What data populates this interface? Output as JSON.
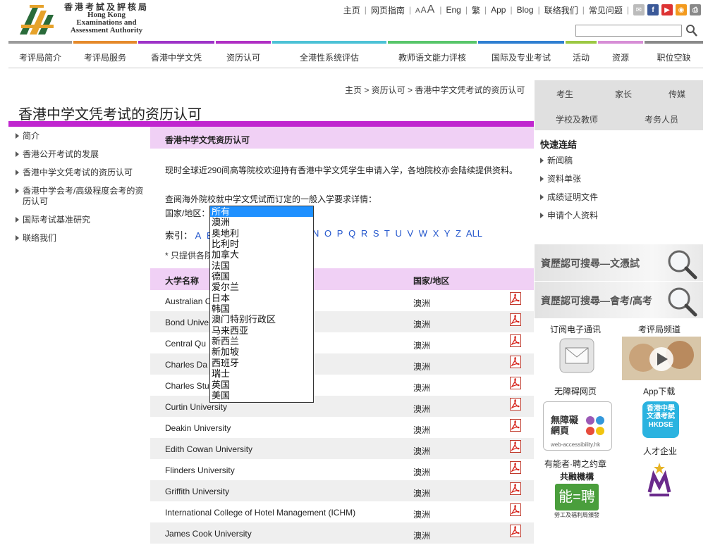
{
  "header": {
    "logo_zh": "香港考試及評核局",
    "logo_en1": "Hong Kong",
    "logo_en2": "Examinations and",
    "logo_en3": "Assessment Authority",
    "links": [
      "主页",
      "网页指南"
    ],
    "font_size_label": "AAA",
    "lang_links": [
      "Eng",
      "繁"
    ],
    "other_links": [
      "App",
      "Blog",
      "联络我们",
      "常见问题"
    ],
    "search_placeholder": ""
  },
  "nav": {
    "items": [
      {
        "label": "考评局简介",
        "color": "#9b9b9b"
      },
      {
        "label": "考评局服务",
        "color": "#e58a2b"
      },
      {
        "label": "香港中学文凭",
        "color": "#9e34c8"
      },
      {
        "label": "资历认可",
        "color": "#b02fc4"
      },
      {
        "label": "全港性系统评估",
        "color": "#4cc2d6"
      },
      {
        "label": "教师语文能力评核",
        "color": "#58c66a"
      },
      {
        "label": "国际及专业考试",
        "color": "#2f7fd1"
      },
      {
        "label": "活动",
        "color": "#9cc843"
      },
      {
        "label": "资源",
        "color": "#d78ed6"
      },
      {
        "label": "职位空缺",
        "color": "#8a8a8a"
      }
    ]
  },
  "breadcrumb": "主页 > 资历认可 > 香港中学文凭考试的资历认可",
  "page_title": "香港中学文凭考试的资历认可",
  "sidebar": {
    "items": [
      {
        "label": "简介"
      },
      {
        "label": "香港公开考试的发展"
      },
      {
        "label": "香港中学文凭考试的资历认可"
      },
      {
        "label": "香港中学会考/高级程度会考的资历认可"
      },
      {
        "label": "国际考试基准研究"
      },
      {
        "label": "联络我们"
      }
    ]
  },
  "content": {
    "section_title": "香港中学文凭资历认可",
    "intro": "现时全球近290间高等院校欢迎持有香港中学文凭学生申请入学，各地院校亦会陆续提供资料。",
    "query": "查阅海外院校就中学文凭试而订定的一般入学要求详情：",
    "region_label": "国家/地区：",
    "index_label": "索引：",
    "index_letters_left": [
      "A",
      "B"
    ],
    "index_letters_right": [
      "N",
      "O",
      "P",
      "Q",
      "R",
      "S",
      "T",
      "U",
      "V",
      "W",
      "X",
      "Y",
      "Z",
      "ALL"
    ],
    "note": "* 只提供各院",
    "col_university": "大学名称",
    "col_country": "国家/地区",
    "rows": [
      {
        "name": "Australian C",
        "country": "澳洲"
      },
      {
        "name": "Bond Unive",
        "country": "澳洲"
      },
      {
        "name": "Central Qu",
        "country": "澳洲"
      },
      {
        "name": "Charles Da",
        "country": "澳洲"
      },
      {
        "name": "Charles Stu",
        "country": "澳洲"
      },
      {
        "name": "Curtin University",
        "country": "澳洲"
      },
      {
        "name": "Deakin University",
        "country": "澳洲"
      },
      {
        "name": "Edith Cowan University",
        "country": "澳洲"
      },
      {
        "name": "Flinders University",
        "country": "澳洲"
      },
      {
        "name": "Griffith University",
        "country": "澳洲"
      },
      {
        "name": "International College of Hotel Management (ICHM)",
        "country": "澳洲"
      },
      {
        "name": "James Cook University",
        "country": "澳洲"
      }
    ]
  },
  "dropdown": {
    "selected": "所有",
    "options": [
      "所有",
      "澳洲",
      "奥地利",
      "比利时",
      "加拿大",
      "法国",
      "德国",
      "爱尔兰",
      "日本",
      "韩国",
      "澳门特别行政区",
      "马来西亚",
      "新西兰",
      "新加坡",
      "西班牙",
      "瑞士",
      "英国",
      "美国"
    ]
  },
  "right": {
    "audiences": [
      "考生",
      "家长",
      "传媒",
      "学校及教师",
      "考务人员"
    ],
    "quick_title": "快速连结",
    "quick_links": [
      "新闻稿",
      "资料单张",
      "成绩证明文件",
      "申请个人资料"
    ],
    "banner1": "資歷認可搜尋—文憑試",
    "banner2": "資歷認可搜尋—會考/高考",
    "tiles": [
      "订阅电子通讯",
      "考评局频道",
      "无障碍网页",
      "App下载",
      "人才企业",
      "有能者·聘之约章"
    ],
    "tile_badge_hkdse": "香港中學文憑考試",
    "tile_badge_hkdse_en": "HKDSE",
    "tile_badge_access": "無障礙網頁",
    "tile_badge_access_url": "web-accessibility.hk",
    "tile_badge_inclusive": "共融機構",
    "tile_badge_inclusive_sub": "勞工及福利局頒發"
  }
}
